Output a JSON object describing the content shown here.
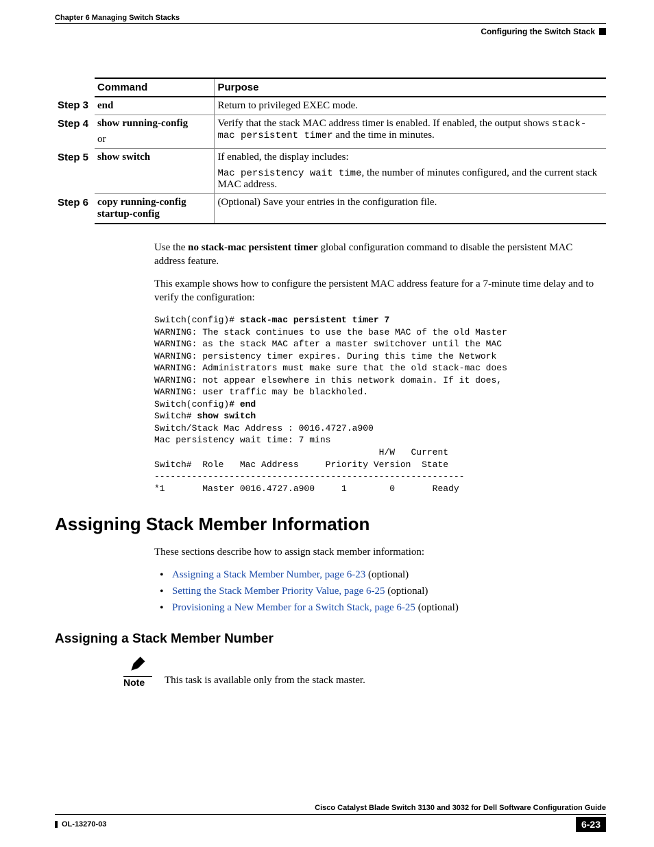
{
  "header": {
    "chapter": "Chapter 6    Managing Switch Stacks",
    "section": "Configuring the Switch Stack"
  },
  "table": {
    "head": {
      "command": "Command",
      "purpose": "Purpose"
    },
    "rows": [
      {
        "step": "Step 3",
        "command": "end",
        "purpose_pre": "Return to privileged EXEC mode.",
        "purpose_mono": "",
        "purpose_post": ""
      },
      {
        "step": "Step 4",
        "command": "show running-config",
        "command_extra": "or",
        "purpose_pre": "Verify that the stack MAC address timer is enabled. If enabled, the output shows ",
        "purpose_mono": "stack-mac persistent timer",
        "purpose_post": " and the time in minutes."
      },
      {
        "step": "Step 5",
        "command": "show switch",
        "purpose_pre": "If enabled, the display includes:",
        "purpose_mono": "Mac persistency wait time",
        "purpose_post": ", the number of minutes configured, and the current stack MAC address."
      },
      {
        "step": "Step 6",
        "command": "copy running-config startup-config",
        "purpose_pre": "(Optional) Save your entries in the configuration file.",
        "purpose_mono": "",
        "purpose_post": ""
      }
    ]
  },
  "body": {
    "p1_a": "Use the ",
    "p1_b": "no stack-mac persistent timer",
    "p1_c": " global configuration command to disable the persistent MAC address feature.",
    "p2": "This example shows how to configure the persistent MAC address feature for a 7-minute time delay and to verify the configuration:",
    "code": {
      "l1a": "Switch(config)# ",
      "l1b": "stack-mac persistent timer 7",
      "l2": "WARNING: The stack continues to use the base MAC of the old Master",
      "l3": "WARNING: as the stack MAC after a master switchover until the MAC",
      "l4": "WARNING: persistency timer expires. During this time the Network",
      "l5": "WARNING: Administrators must make sure that the old stack-mac does",
      "l6": "WARNING: not appear elsewhere in this network domain. If it does,",
      "l7": "WARNING: user traffic may be blackholed.",
      "l8a": "Switch(config)",
      "l8b": "# end",
      "l9a": "Switch# ",
      "l9b": "show switch",
      "l10": "Switch/Stack Mac Address : 0016.4727.a900",
      "l11": "Mac persistency wait time: 7 mins",
      "l12": "                                          H/W   Current",
      "l13": "Switch#  Role   Mac Address     Priority Version  State",
      "l14": "----------------------------------------------------------",
      "l15": "*1       Master 0016.4727.a900     1        0       Ready"
    }
  },
  "sec1": {
    "title": "Assigning Stack Member Information",
    "intro": "These sections describe how to assign stack member information:",
    "links": [
      {
        "text": "Assigning a Stack Member Number, page 6-23",
        "suffix": " (optional)"
      },
      {
        "text": "Setting the Stack Member Priority Value, page 6-25",
        "suffix": " (optional)"
      },
      {
        "text": "Provisioning a New Member for a Switch Stack, page 6-25",
        "suffix": " (optional)"
      }
    ]
  },
  "sec2": {
    "title": "Assigning a Stack Member Number",
    "note_label": "Note",
    "note_text": "This task is available only from the stack master."
  },
  "footer": {
    "book": "Cisco Catalyst Blade Switch 3130 and 3032 for Dell Software Configuration Guide",
    "doc": "OL-13270-03",
    "page": "6-23"
  }
}
